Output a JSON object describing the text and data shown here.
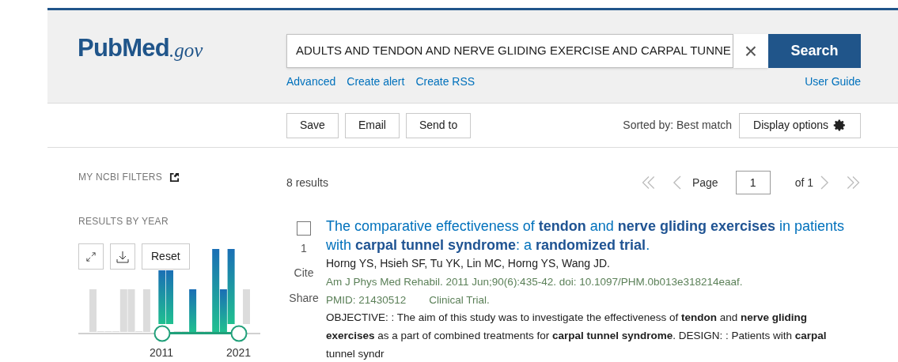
{
  "header": {
    "logo": {
      "main": "PubMed",
      "suffix": ".gov"
    },
    "search": {
      "value": "ADULTS AND TENDON AND NERVE GLIDING EXERCISE AND CARPAL TUNNE",
      "clear": "×",
      "button": "Search"
    },
    "links": [
      "Advanced",
      "Create alert",
      "Create RSS"
    ],
    "user_guide": "User Guide"
  },
  "actions": {
    "buttons": [
      "Save",
      "Email",
      "Send to"
    ],
    "sorted_by": "Sorted by: Best match",
    "display_options": "Display options"
  },
  "sidebar": {
    "my_filters": "MY NCBI FILTERS",
    "results_by_year": "RESULTS BY YEAR",
    "reset": "Reset",
    "year_from": "2011",
    "year_to": "2021"
  },
  "results": {
    "count": "8 results",
    "pager": {
      "page_label": "Page",
      "page": "1",
      "of": "of 1"
    },
    "items": [
      {
        "number": "1",
        "checked": false,
        "title": "The comparative effectiveness of **tendon** and **nerve gliding exercises** in patients with **carpal tunnel syndrome**: a **randomized trial**.",
        "authors": "Horng YS, Hsieh SF, Tu YK, Lin MC, Horng YS, Wang JD.",
        "citation": "Am J Phys Med Rehabil. 2011 Jun;90(6):435-42. doi: 10.1097/PHM.0b013e318214eaaf.",
        "pmid": "PMID: 21430512",
        "type": "Clinical Trial.",
        "cite": "Cite",
        "share": "Share",
        "snippet": "OBJECTIVE: : The aim of this study was to investigate the effectiveness of **tendon** and **nerve gliding** **exercises** as a part of combined treatments for **carpal tunnel syndrome**. DESIGN: : Patients with **carpal** tunnel syndr"
      }
    ]
  }
}
